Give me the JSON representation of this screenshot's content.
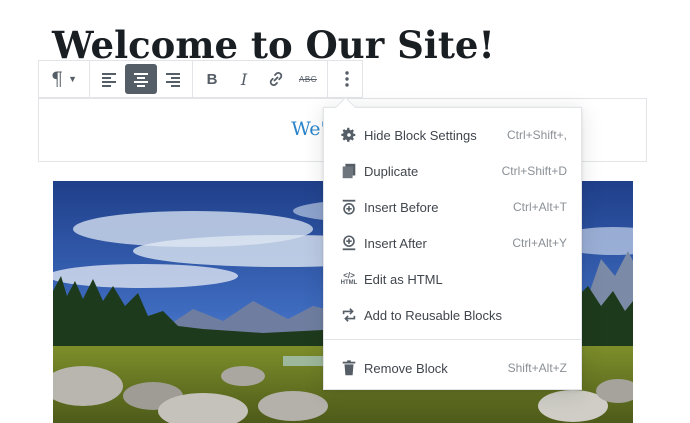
{
  "page": {
    "title": "Welcome to Our Site!"
  },
  "paragraph": {
    "text": "We're glad"
  },
  "toolbar": {
    "paragraph_icon": "¶",
    "buttons": [
      "paragraph-switcher",
      "align-left",
      "align-center",
      "align-right",
      "bold",
      "italic",
      "link",
      "strikethrough",
      "more-options"
    ],
    "active": "align-center",
    "bold_label": "B",
    "italic_label": "I",
    "strike_label": "ABC"
  },
  "menu": {
    "items": [
      {
        "icon": "gear-icon",
        "label": "Hide Block Settings",
        "shortcut": "Ctrl+Shift+,"
      },
      {
        "icon": "duplicate-icon",
        "label": "Duplicate",
        "shortcut": "Ctrl+Shift+D"
      },
      {
        "icon": "insert-before-icon",
        "label": "Insert Before",
        "shortcut": "Ctrl+Alt+T"
      },
      {
        "icon": "insert-after-icon",
        "label": "Insert After",
        "shortcut": "Ctrl+Alt+Y"
      },
      {
        "icon": "html-icon",
        "label": "Edit as HTML",
        "shortcut": ""
      },
      {
        "icon": "reusable-icon",
        "label": "Add to Reusable Blocks",
        "shortcut": ""
      },
      {
        "icon": "trash-icon",
        "label": "Remove Block",
        "shortcut": "Shift+Alt+Z"
      }
    ],
    "html_icon_text": "HTML"
  },
  "colors": {
    "accent": "#2b84c8",
    "active_button": "#555d66"
  }
}
